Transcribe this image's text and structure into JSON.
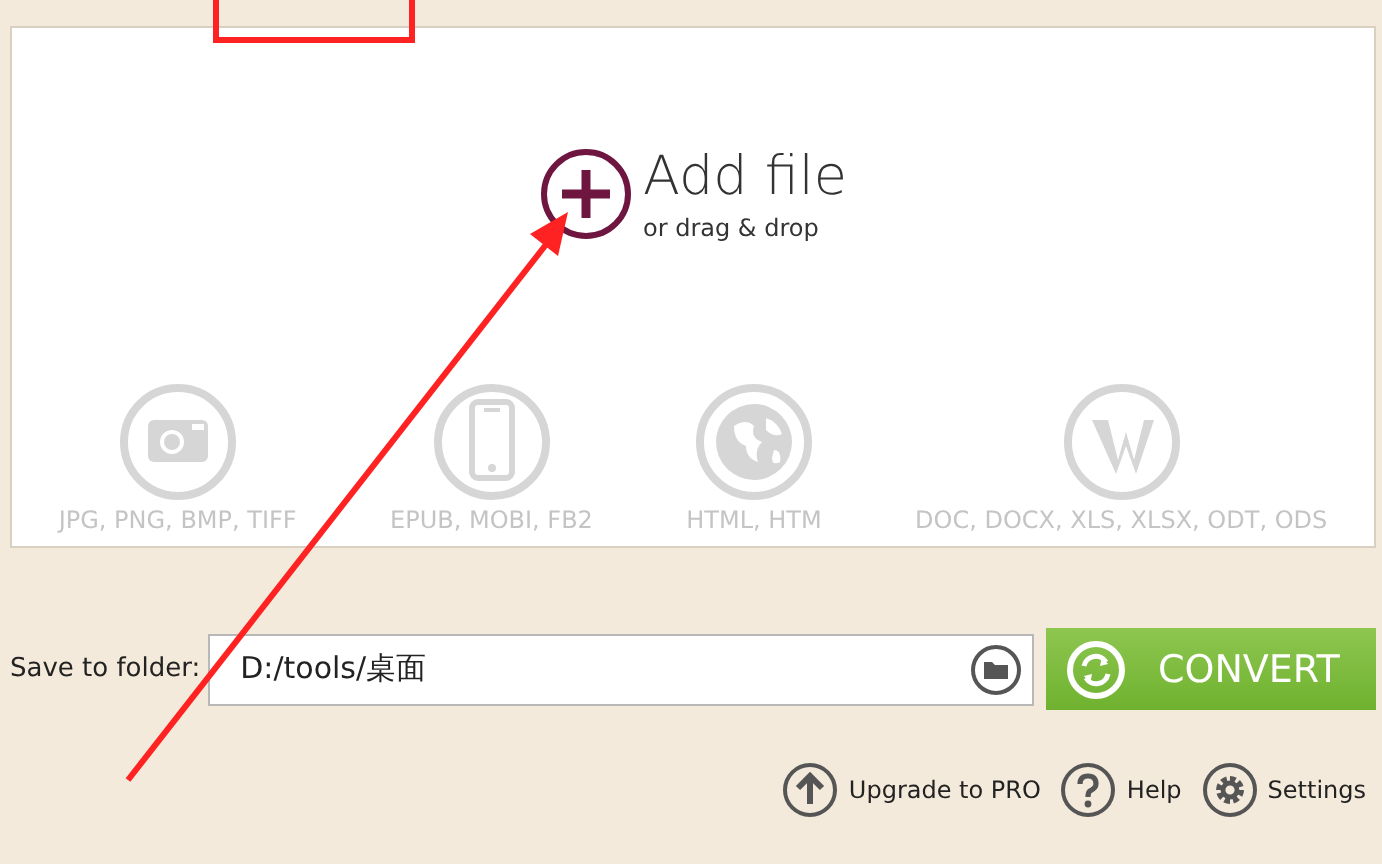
{
  "drop_area": {
    "title": "Add file",
    "subtitle": "or drag & drop"
  },
  "formats": [
    {
      "kind": "image",
      "label": "JPG, PNG, BMP, TIFF"
    },
    {
      "kind": "ebook",
      "label": "EPUB, MOBI, FB2"
    },
    {
      "kind": "web",
      "label": "HTML, HTM"
    },
    {
      "kind": "document",
      "label": "DOC, DOCX, XLS, XLSX, ODT, ODS"
    }
  ],
  "save": {
    "label": "Save to folder:",
    "value": "D:/tools/桌面"
  },
  "convert_button": "CONVERT",
  "footer": [
    {
      "kind": "upgrade",
      "label": "Upgrade to PRO"
    },
    {
      "kind": "help",
      "label": "Help"
    },
    {
      "kind": "settings",
      "label": "Settings"
    }
  ]
}
